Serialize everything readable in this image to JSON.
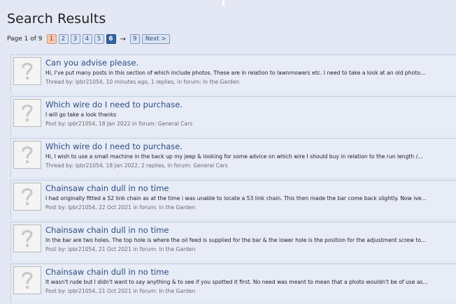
{
  "page": {
    "title": "Search Results"
  },
  "pagination": {
    "label": "Page 1 of 9",
    "pages": [
      "1",
      "2",
      "3",
      "4",
      "5",
      "6"
    ],
    "arrow": "→",
    "last_page": "9",
    "next_label": "Next >"
  },
  "results": [
    {
      "title": "Can you advise please.",
      "snippet": "Hi, I've put many posts in this section of which include photos. These are in relation to lawnmowers etc. I need to take a look at an old photo...",
      "meta": "Thread by: ipbr21054, 10 minutes ago, 1 replies, in forum: In the Garden"
    },
    {
      "title": "Which wire do I need to purchase.",
      "snippet": "I will go take a look thanks",
      "meta": "Post by: ipbr21054, 18 Jan 2022 in forum: General Cars"
    },
    {
      "title": "Which wire do I need to purchase.",
      "snippet": "Hi, I wish to use a small machine in the back up my jeep & looking for some advice on which wire I should buy in relation to the run length /...",
      "meta": "Thread by: ipbr21054, 18 Jan 2022, 2 replies, in forum: General Cars"
    },
    {
      "title": "Chainsaw chain dull in no time",
      "snippet": "I had originally fitted a 52 link chain as at the time i was unable to locate a 53 link chain. This then made the bar come back slightly. Now ive...",
      "meta": "Post by: ipbr21054, 22 Oct 2021 in forum: In the Garden"
    },
    {
      "title": "Chainsaw chain dull in no time",
      "snippet": "In the bar are two holes. The top hole is where the oil feed is supplied for the bar & the lower hole is the position for the adjustment screw to...",
      "meta": "Post by: ipbr21054, 21 Oct 2021 in forum: In the Garden"
    },
    {
      "title": "Chainsaw chain dull in no time",
      "snippet": "It wasn't rude but I didn't want to say anything & to see if you spotted it first. No need was meant to mean that a photo wouldn't be of use as...",
      "meta": "Post by: ipbr21054, 21 Oct 2021 in forum: In the Garden"
    }
  ]
}
